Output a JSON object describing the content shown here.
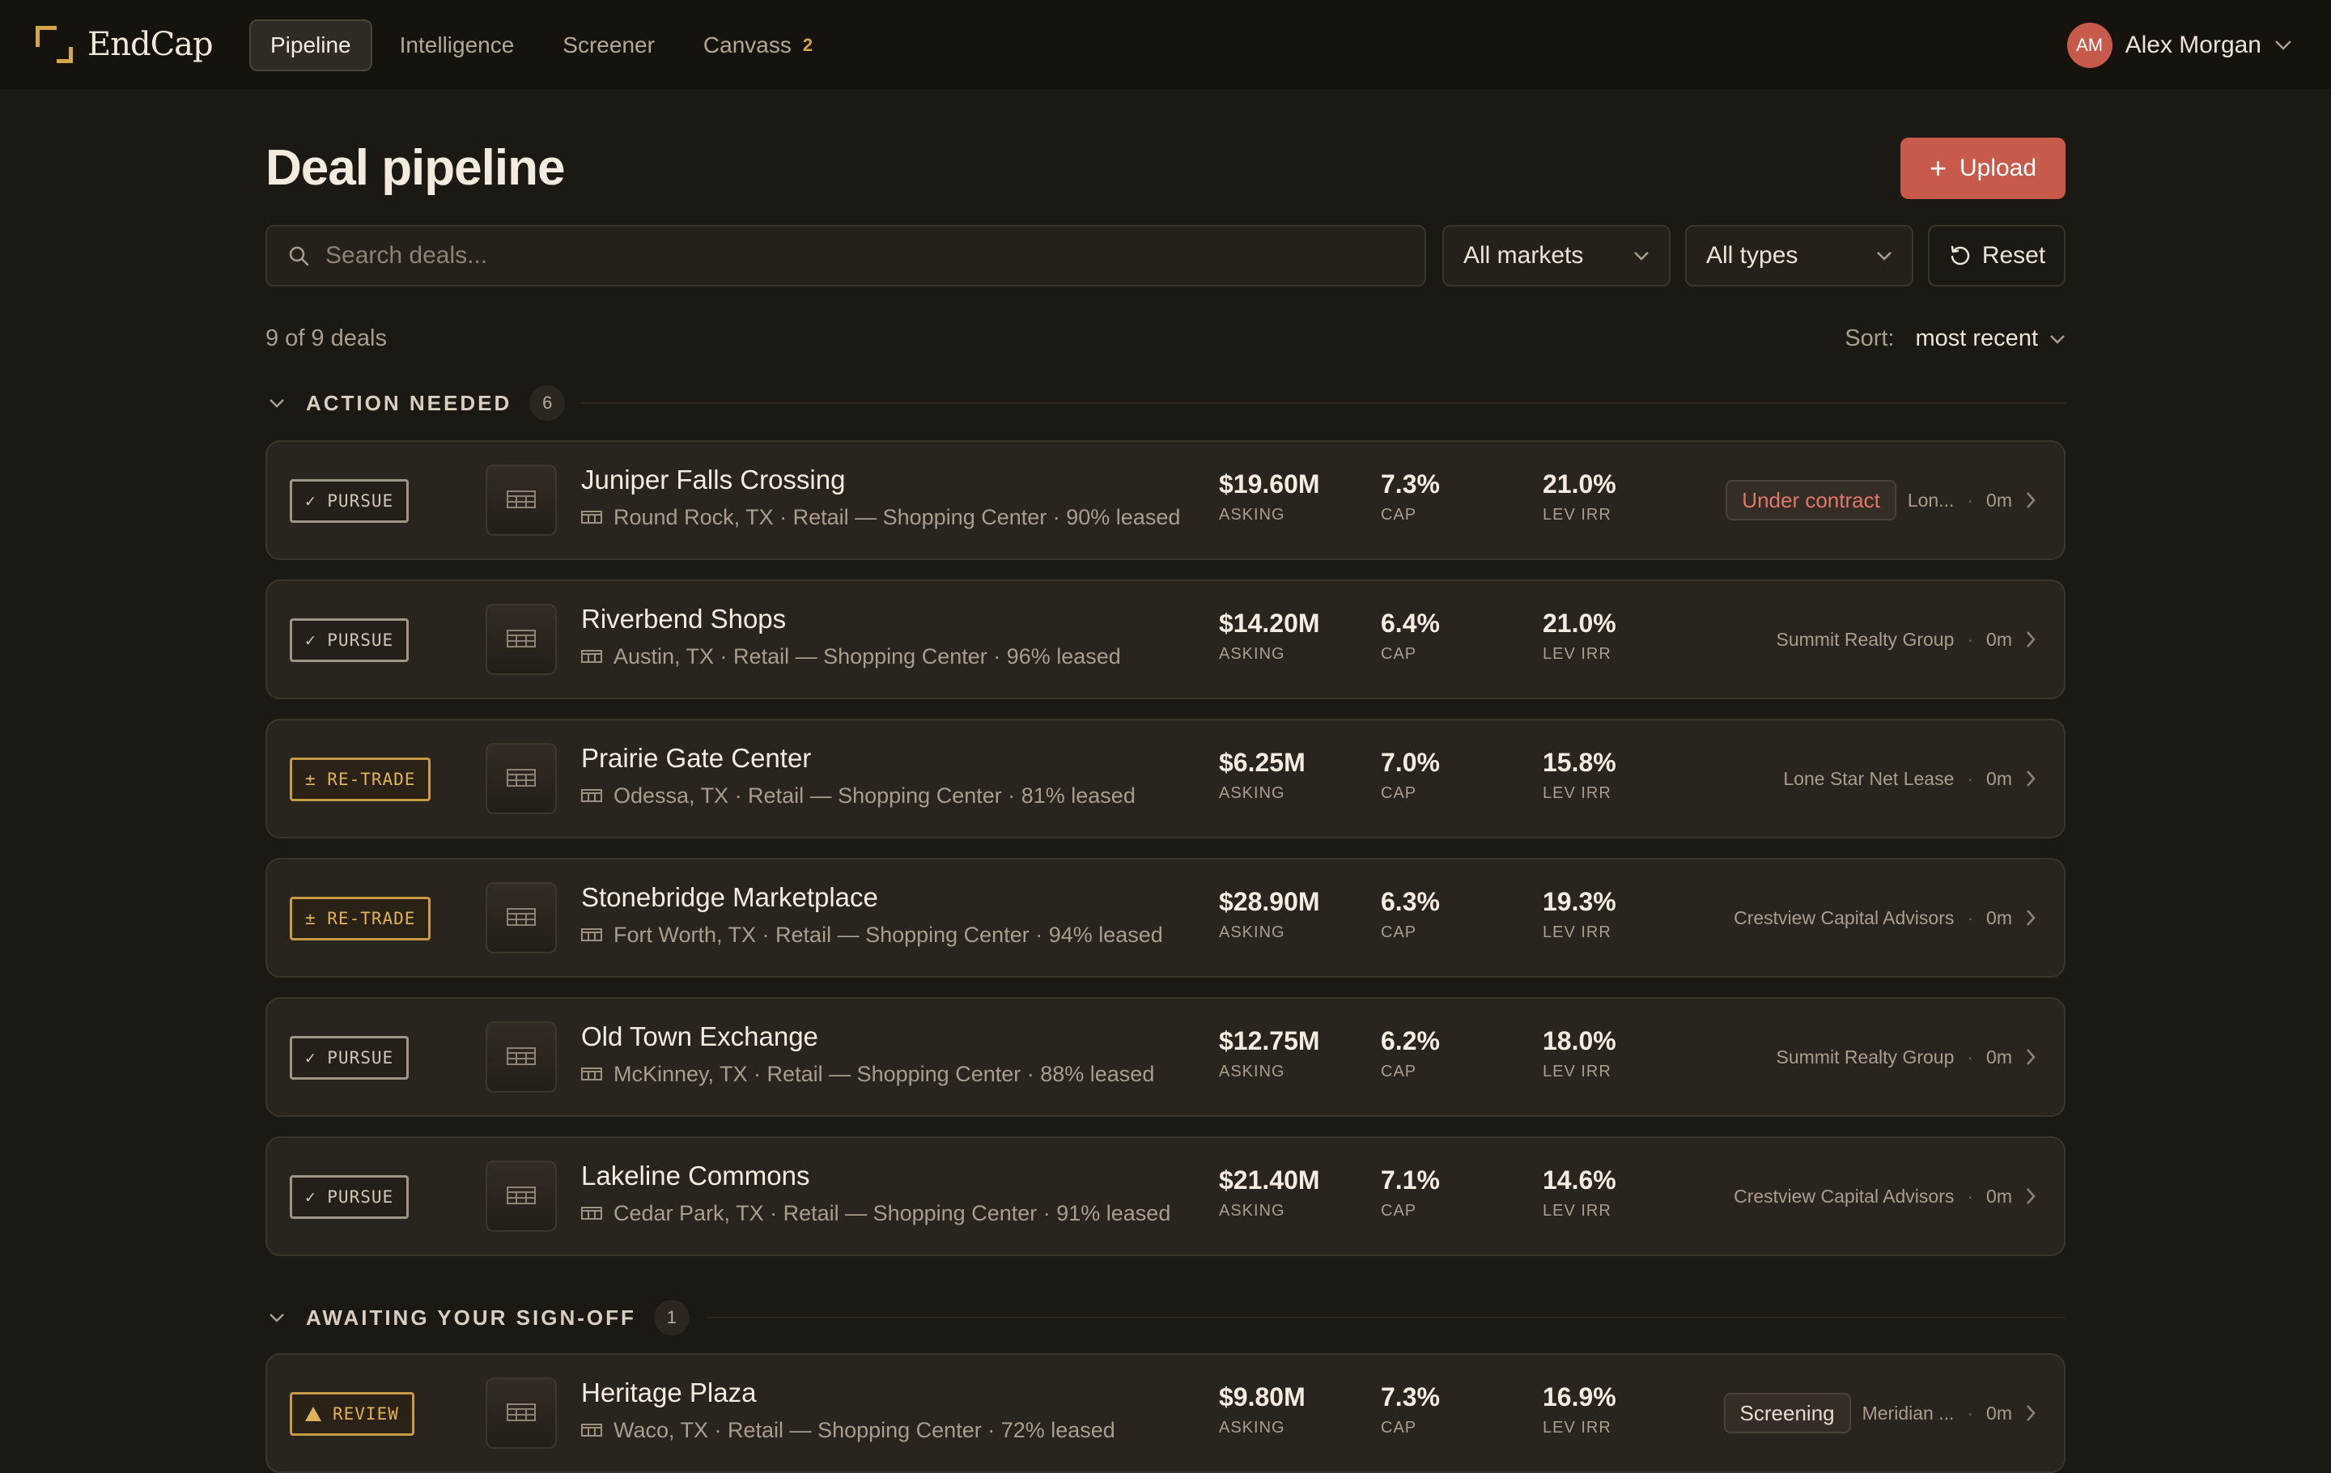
{
  "app": {
    "name": "EndCap"
  },
  "nav": {
    "items": [
      {
        "label": "Pipeline"
      },
      {
        "label": "Intelligence"
      },
      {
        "label": "Screener"
      },
      {
        "label": "Canvass",
        "badge": "2"
      }
    ]
  },
  "user": {
    "initials": "AM",
    "name": "Alex Morgan"
  },
  "page": {
    "title": "Deal pipeline",
    "upload_label": "Upload"
  },
  "filters": {
    "search_placeholder": "Search deals...",
    "market": "All markets",
    "type": "All types",
    "reset_label": "Reset"
  },
  "summary": {
    "count": "9 of 9 deals",
    "sort_label": "Sort:",
    "sort_value": "most recent"
  },
  "sections": [
    {
      "title": "ACTION NEEDED",
      "count": "6",
      "deals": [
        {
          "tag": "✓ PURSUE",
          "tag_kind": "pursue",
          "name": "Juniper Falls Crossing",
          "sub": "Round Rock, TX · Retail — Shopping Center · 90% leased",
          "asking": "$19.60M",
          "asking_label": "ASKING",
          "cap": "7.3%",
          "cap_label": "CAP",
          "irr": "21.0%",
          "irr_label": "LEV IRR",
          "status": "Under contract",
          "broker": "Lon...",
          "age": "0m"
        },
        {
          "tag": "✓ PURSUE",
          "tag_kind": "pursue",
          "name": "Riverbend Shops",
          "sub": "Austin, TX · Retail — Shopping Center · 96% leased",
          "asking": "$14.20M",
          "asking_label": "ASKING",
          "cap": "6.4%",
          "cap_label": "CAP",
          "irr": "21.0%",
          "irr_label": "LEV IRR",
          "status": "",
          "broker": "Summit Realty Group",
          "age": "0m"
        },
        {
          "tag": "± RE-TRADE",
          "tag_kind": "retrade",
          "name": "Prairie Gate Center",
          "sub": "Odessa, TX · Retail — Shopping Center · 81% leased",
          "asking": "$6.25M",
          "asking_label": "ASKING",
          "cap": "7.0%",
          "cap_label": "CAP",
          "irr": "15.8%",
          "irr_label": "LEV IRR",
          "status": "",
          "broker": "Lone Star Net Lease",
          "age": "0m"
        },
        {
          "tag": "± RE-TRADE",
          "tag_kind": "retrade",
          "name": "Stonebridge Marketplace",
          "sub": "Fort Worth, TX · Retail — Shopping Center · 94% leased",
          "asking": "$28.90M",
          "asking_label": "ASKING",
          "cap": "6.3%",
          "cap_label": "CAP",
          "irr": "19.3%",
          "irr_label": "LEV IRR",
          "status": "",
          "broker": "Crestview Capital Advisors",
          "age": "0m"
        },
        {
          "tag": "✓ PURSUE",
          "tag_kind": "pursue",
          "name": "Old Town Exchange",
          "sub": "McKinney, TX · Retail — Shopping Center · 88% leased",
          "asking": "$12.75M",
          "asking_label": "ASKING",
          "cap": "6.2%",
          "cap_label": "CAP",
          "irr": "18.0%",
          "irr_label": "LEV IRR",
          "status": "",
          "broker": "Summit Realty Group",
          "age": "0m"
        },
        {
          "tag": "✓ PURSUE",
          "tag_kind": "pursue",
          "name": "Lakeline Commons",
          "sub": "Cedar Park, TX · Retail — Shopping Center · 91% leased",
          "asking": "$21.40M",
          "asking_label": "ASKING",
          "cap": "7.1%",
          "cap_label": "CAP",
          "irr": "14.6%",
          "irr_label": "LEV IRR",
          "status": "",
          "broker": "Crestview Capital Advisors",
          "age": "0m"
        }
      ]
    },
    {
      "title": "AWAITING YOUR SIGN-OFF",
      "count": "1",
      "deals": [
        {
          "tag": "REVIEW",
          "tag_kind": "review",
          "name": "Heritage Plaza",
          "sub": "Waco, TX · Retail — Shopping Center · 72% leased",
          "asking": "$9.80M",
          "asking_label": "ASKING",
          "cap": "7.3%",
          "cap_label": "CAP",
          "irr": "16.9%",
          "irr_label": "LEV IRR",
          "status": "Screening",
          "broker": "Meridian ...",
          "age": "0m"
        }
      ]
    }
  ],
  "colors": {
    "accent": "#c85a4b",
    "gold": "#d4a64a",
    "background": "#1c1814",
    "card": "#2a241e"
  },
  "icons": [
    "search-icon",
    "chevron-down-icon",
    "reset-icon",
    "plus-icon",
    "building-icon",
    "chevron-right-icon"
  ]
}
